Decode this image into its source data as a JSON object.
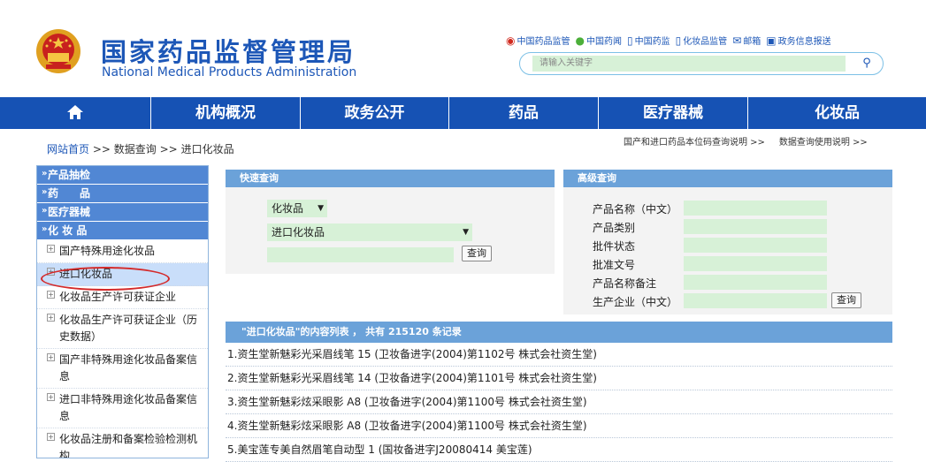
{
  "header": {
    "title_cn": "国家药品监督管理局",
    "title_en": "National Medical Products Administration",
    "top_links": [
      {
        "icon": "weibo-icon",
        "label": "中国药品监管"
      },
      {
        "icon": "wechat-icon",
        "label": "中国药闻"
      },
      {
        "icon": "phone-icon",
        "label": "中国药监"
      },
      {
        "icon": "phone-icon",
        "label": "化妆品监管"
      },
      {
        "icon": "mail-icon",
        "label": "邮箱"
      },
      {
        "icon": "monitor-icon",
        "label": "政务信息报送"
      }
    ],
    "search_placeholder": "请输入关键字"
  },
  "nav": {
    "home_icon": "home-icon",
    "items": [
      "机构概况",
      "政务公开",
      "药品",
      "医疗器械",
      "化妆品"
    ]
  },
  "breadcrumb": {
    "home": "网站首页",
    "sep": ">>",
    "data_query": "数据查询",
    "current": "进口化妆品"
  },
  "right_links": [
    "国产和进口药品本位码查询说明 >>",
    "数据查询使用说明 >>"
  ],
  "sidebar": {
    "categories": [
      "产品抽检",
      "药　　品",
      "医疗器械",
      "化 妆 品"
    ],
    "items": [
      "国产特殊用途化妆品",
      "进口化妆品",
      "化妆品生产许可获证企业",
      "化妆品生产许可获证企业（历史数据）",
      "国产非特殊用途化妆品备案信息",
      "进口非特殊用途化妆品备案信息",
      "化妆品注册和备案检验检测机构"
    ],
    "active_index": 1
  },
  "quick_query": {
    "title": "快速查询",
    "category_select": "化妆品",
    "subcategory_select": "进口化妆品",
    "keyword_value": "",
    "query_button": "查询"
  },
  "advanced_query": {
    "title": "高级查询",
    "fields": [
      "产品名称（中文）",
      "产品类别",
      "批件状态",
      "批准文号",
      "产品名称备注",
      "生产企业（中文）"
    ],
    "query_button": "查询"
  },
  "results": {
    "header": "\"进口化妆品\"的内容列表 ， 共有 215120 条记录",
    "total": 215120,
    "rows": [
      "1.资生堂新魅彩光采眉线笔 15 (卫妆备进字(2004)第1102号 株式会社资生堂)",
      "2.资生堂新魅彩光采眉线笔 14 (卫妆备进字(2004)第1101号 株式会社资生堂)",
      "3.资生堂新魅彩炫采眼影 A8 (卫妆备进字(2004)第1100号 株式会社资生堂)",
      "4.资生堂新魅彩炫采眼影 A8 (卫妆备进字(2004)第1100号 株式会社资生堂)",
      "5.美宝莲专美自然眉笔自动型 1 (国妆备进字J20080414 美宝莲)"
    ]
  },
  "colors": {
    "brand_blue": "#1d57b7",
    "nav_blue": "#1652b4",
    "panel_blue": "#6ba2d9",
    "field_green": "#d7f1d7",
    "highlight_red": "#d42a2a"
  }
}
